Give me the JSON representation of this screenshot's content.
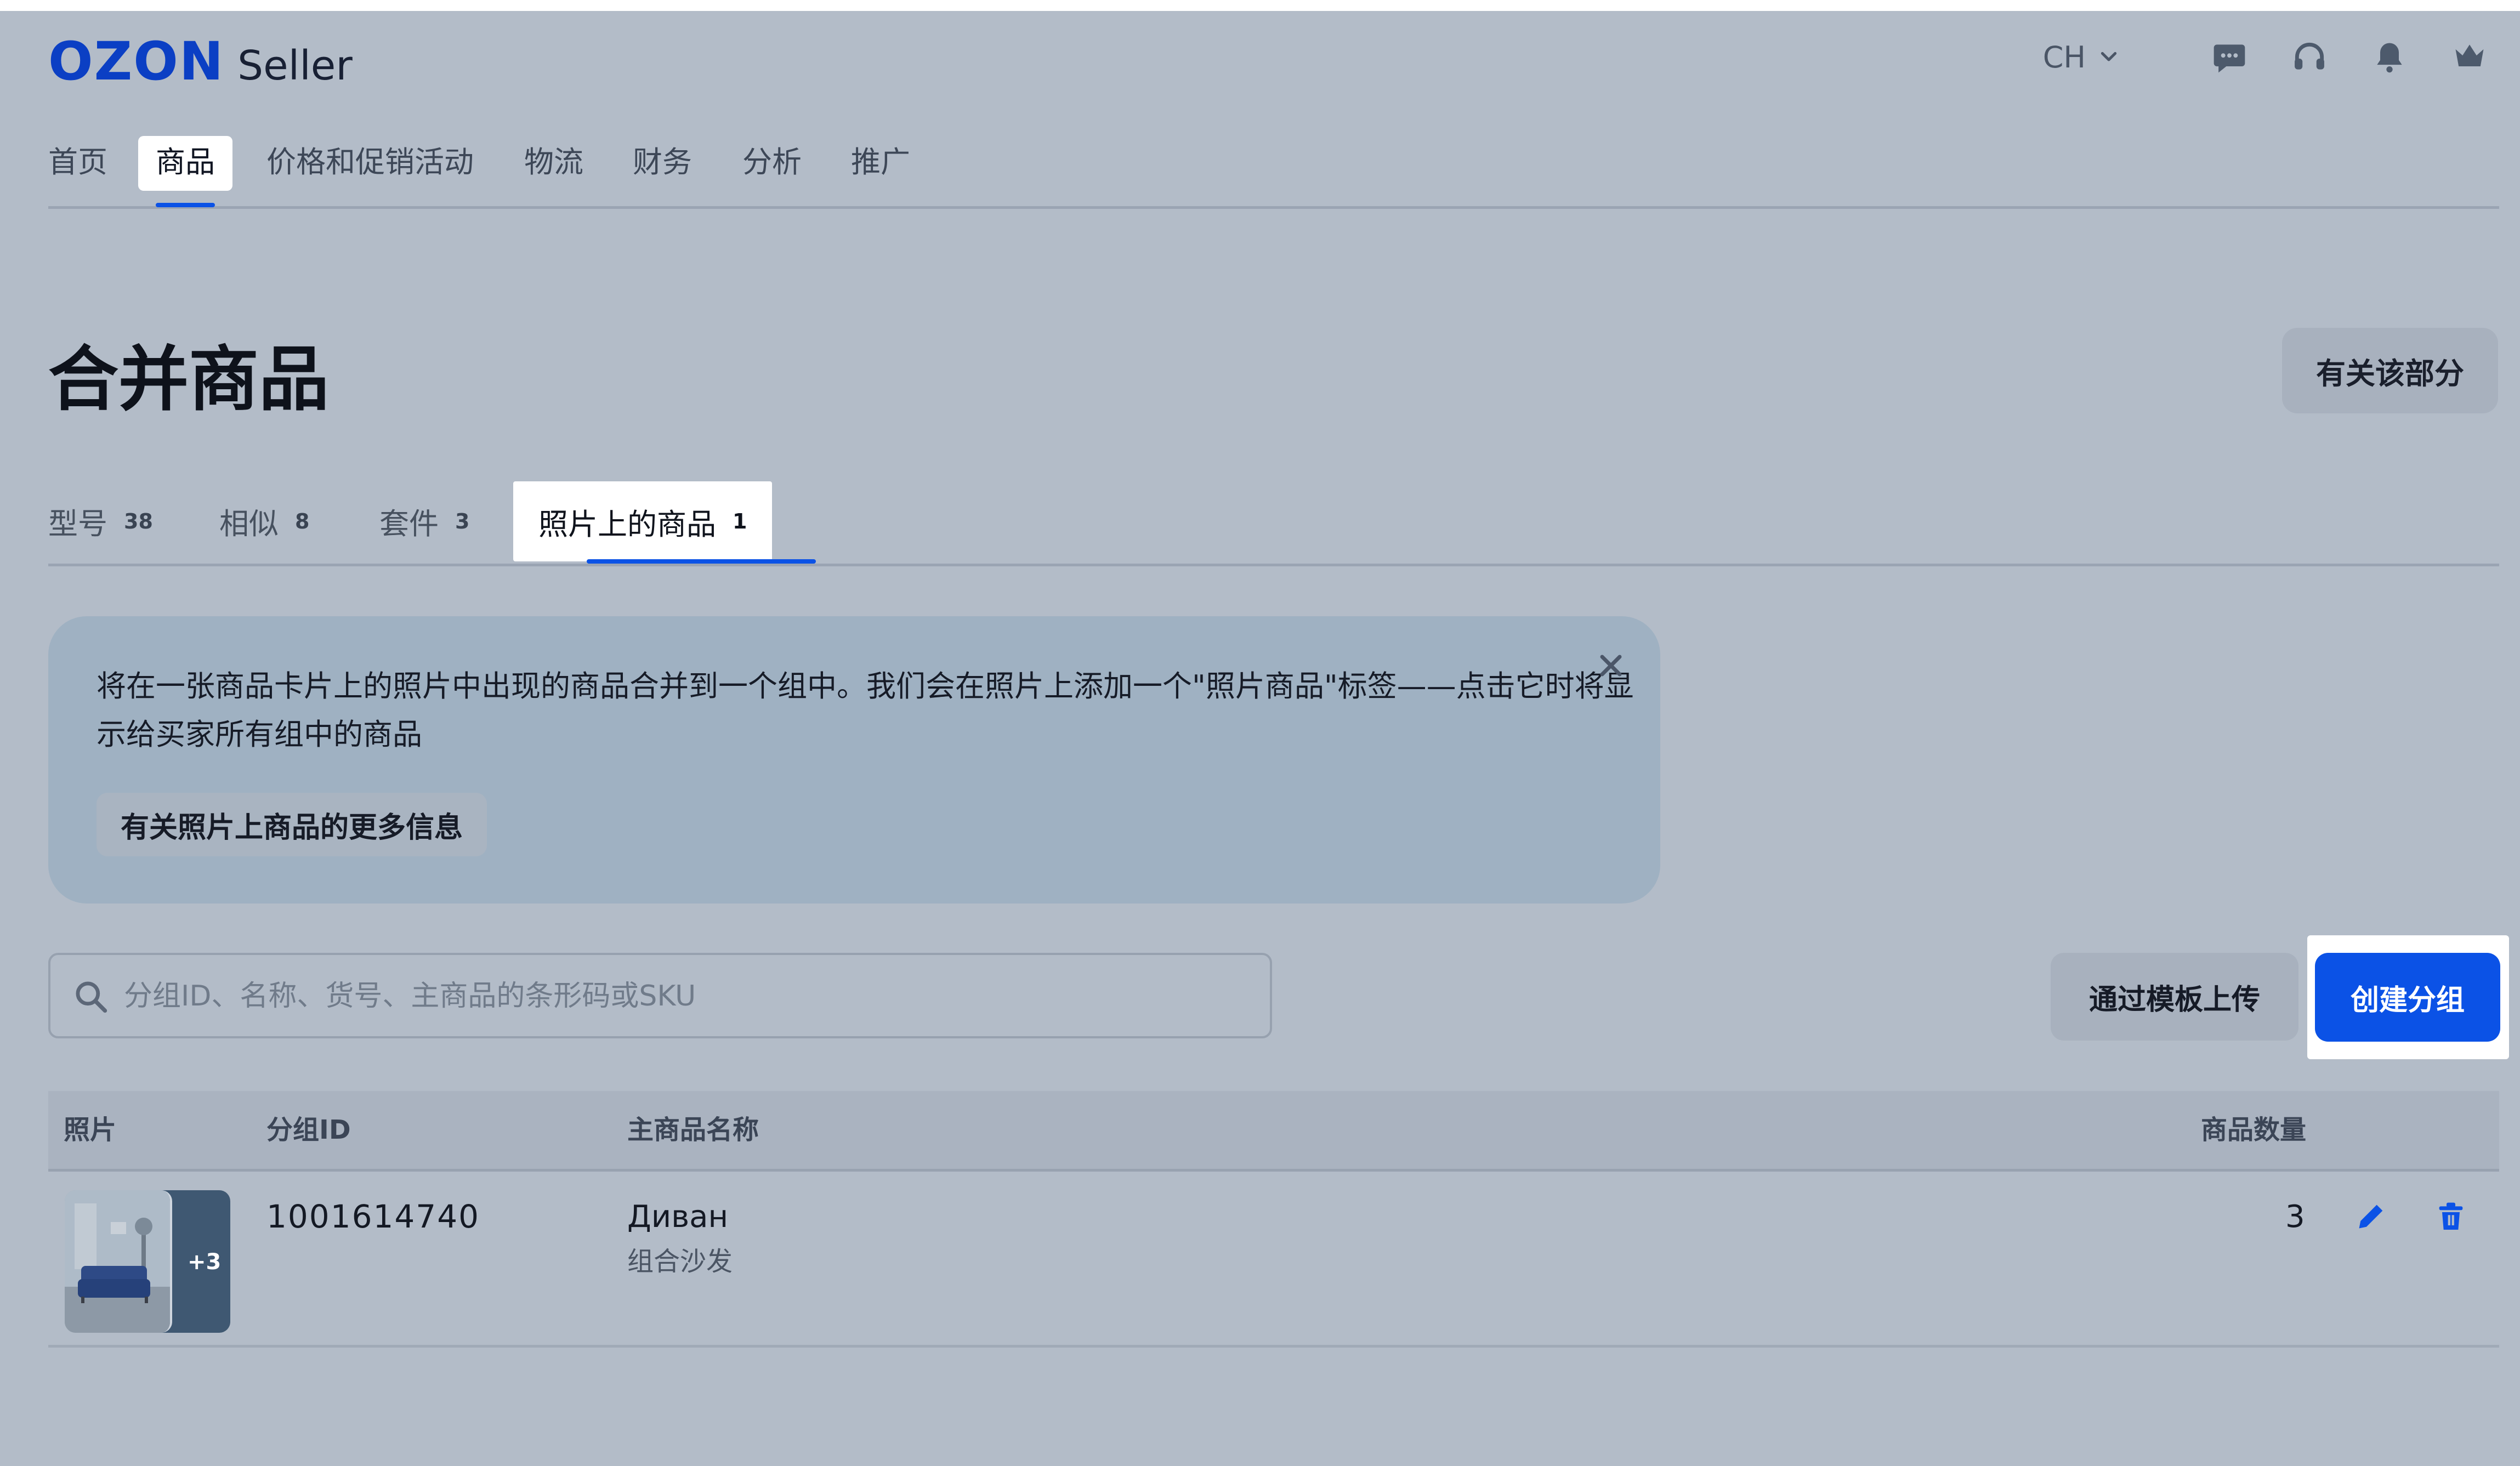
{
  "header": {
    "logo_mark": "OZON",
    "logo_text": "Seller",
    "language": "CH",
    "icons": [
      "chat-icon",
      "support-headset-icon",
      "bell-icon",
      "crown-icon"
    ]
  },
  "nav": {
    "items": [
      {
        "label": "首页"
      },
      {
        "label": "商品",
        "active": true
      },
      {
        "label": "价格和促销活动"
      },
      {
        "label": "物流"
      },
      {
        "label": "财务"
      },
      {
        "label": "分析"
      },
      {
        "label": "推广"
      }
    ]
  },
  "page": {
    "title": "合并商品",
    "about_button": "有关该部分"
  },
  "tabs": [
    {
      "label": "型号",
      "count": "38"
    },
    {
      "label": "相似",
      "count": "8"
    },
    {
      "label": "套件",
      "count": "3"
    },
    {
      "label": "照片上的商品",
      "count": "1",
      "active": true
    }
  ],
  "banner": {
    "text": "将在一张商品卡片上的照片中出现的商品合并到一个组中。我们会在照片上添加一个\"照片商品\"标签——点击它时将显示给买家所有组中的商品",
    "link_label": "有关照片上商品的更多信息"
  },
  "search": {
    "placeholder": "分组ID、名称、货号、主商品的条形码或SKU",
    "value": ""
  },
  "actions": {
    "upload_label": "通过模板上传",
    "create_label": "创建分组"
  },
  "table": {
    "columns": [
      "照片",
      "分组ID",
      "主商品名称",
      "商品数量"
    ],
    "rows": [
      {
        "extra_photos": "+3",
        "group_id": "1001614740",
        "name": "Диван",
        "subtitle": "组合沙发",
        "count": "3"
      }
    ]
  },
  "colors": {
    "accent": "#0b52e6",
    "logo": "#0b3fc4",
    "overlay_bg": "#b3bcc8"
  }
}
